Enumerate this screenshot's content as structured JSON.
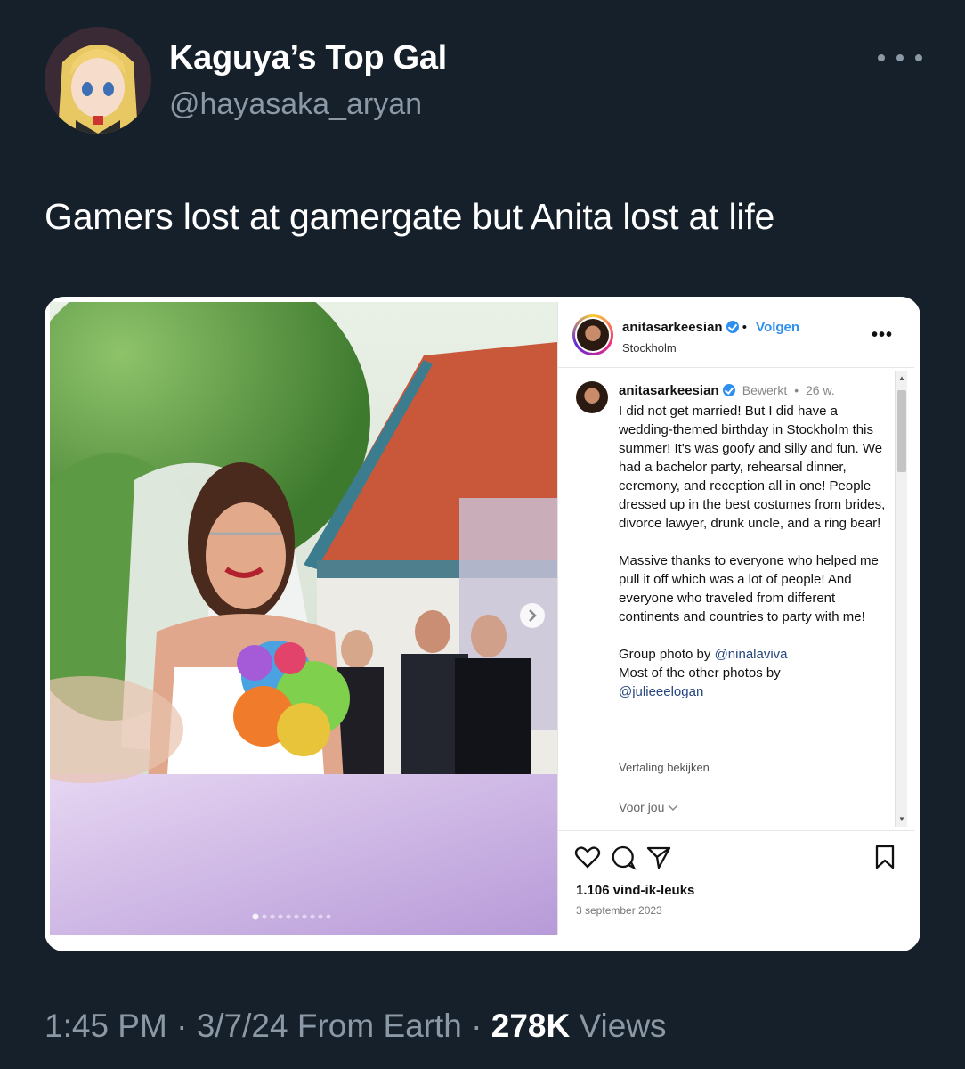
{
  "tweet": {
    "display_name": "Kaguya’s Top Gal",
    "handle": "@hayasaka_aryan",
    "text": "Gamers lost at gamergate but Anita lost at life",
    "time": "1:45 PM",
    "date": "3/7/24",
    "source": "From Earth",
    "views_count": "278K",
    "views_label": "Views",
    "separator": "·"
  },
  "instagram": {
    "username": "anitasarkeesian",
    "follow_label": "Volgen",
    "location": "Stockholm",
    "more_label": "•••",
    "caption_username": "anitasarkeesian",
    "edited_label": "Bewerkt",
    "age": "26 w.",
    "caption_p1": "I did not get married! But I did have a wedding-themed birthday in Stockholm this summer! It's was goofy and silly and fun. We had a bachelor party, rehearsal dinner, ceremony, and reception all in one! People dressed up in the best costumes from brides, divorce lawyer, drunk uncle, and a ring bear!",
    "caption_p2": "Massive thanks to everyone who helped me pull it off which was a lot of people! And everyone who traveled from different continents and countries to party with me!",
    "photo_credit_prefix": "Group photo by",
    "photo_credit_mention": "@ninalaviva",
    "other_photos_prefix": "Most of the other photos by",
    "other_photos_mention": "@julieeelogan",
    "translate_label": "Vertaling bekijken",
    "for_you_label": "Voor jou",
    "likes": "1.106 vind-ik-leuks",
    "date": "3 september 2023",
    "carousel_count": 10,
    "carousel_active": 1
  },
  "icons": [
    "more-icon",
    "verified-icon",
    "next-arrow-icon",
    "heart-icon",
    "comment-icon",
    "share-icon",
    "bookmark-icon",
    "chevron-down-icon"
  ],
  "colors": {
    "background": "#15202b",
    "secondary_text": "#8b98a5",
    "ig_link": "#2f8ff0"
  }
}
